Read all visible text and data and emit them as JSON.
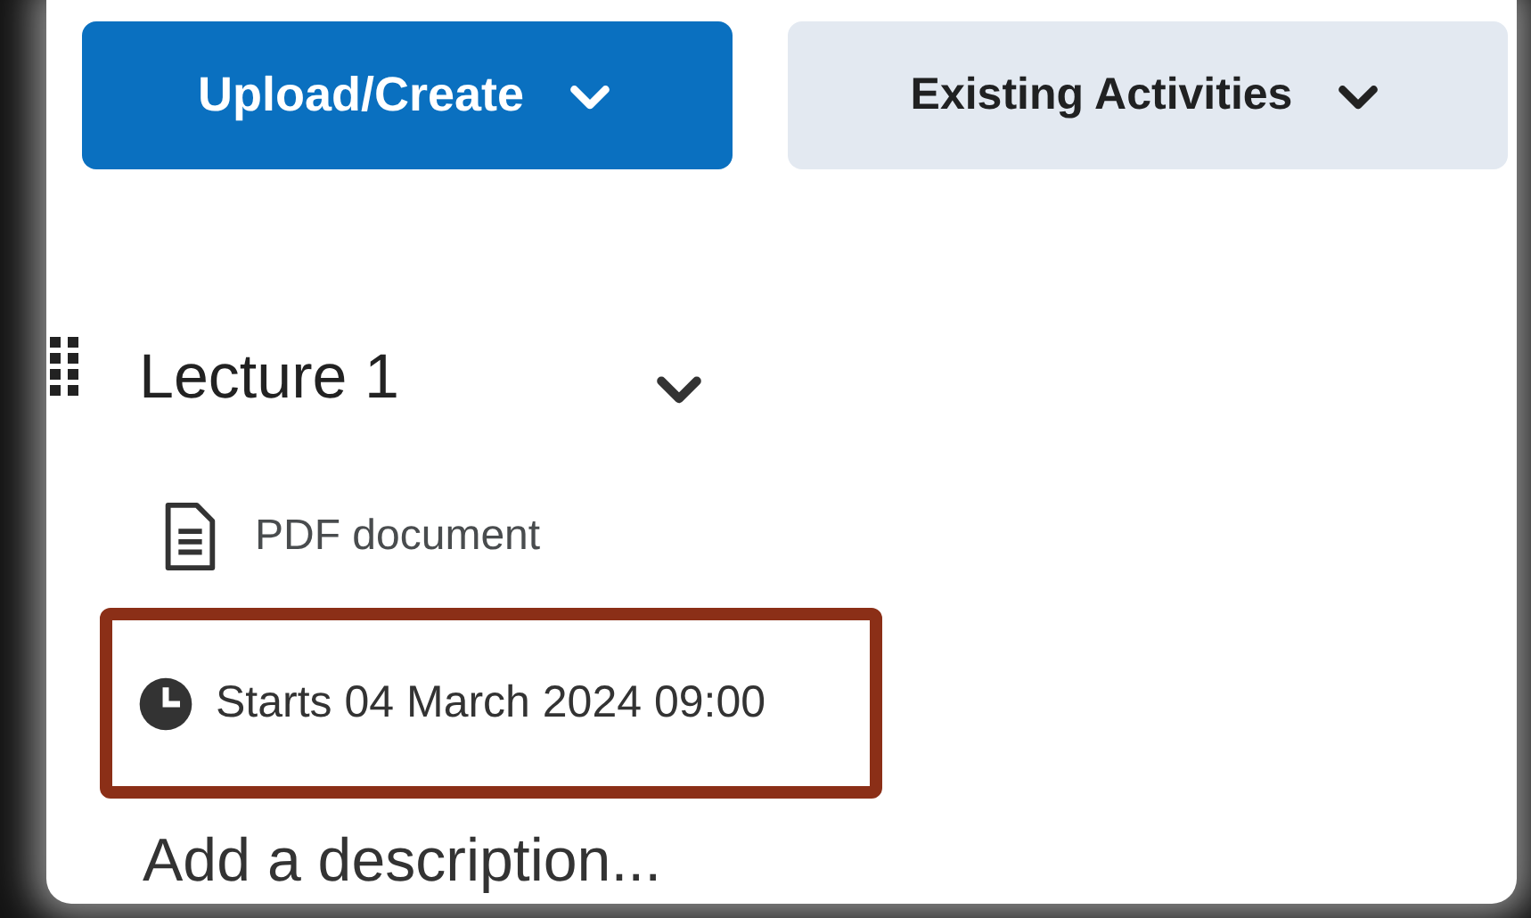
{
  "toolbar": {
    "buttons": [
      {
        "label": "Upload/Create",
        "kind": "primary"
      },
      {
        "label": "Existing Activities",
        "kind": "secondary"
      }
    ]
  },
  "module": {
    "title": "Lecture 1",
    "expanded": true,
    "items": [
      {
        "kind": "document",
        "label": "PDF document",
        "highlighted": false
      },
      {
        "kind": "date",
        "label": "Starts 04 March 2024 09:00",
        "highlighted": true
      }
    ],
    "description": {
      "placeholder": "Add a description..."
    }
  }
}
